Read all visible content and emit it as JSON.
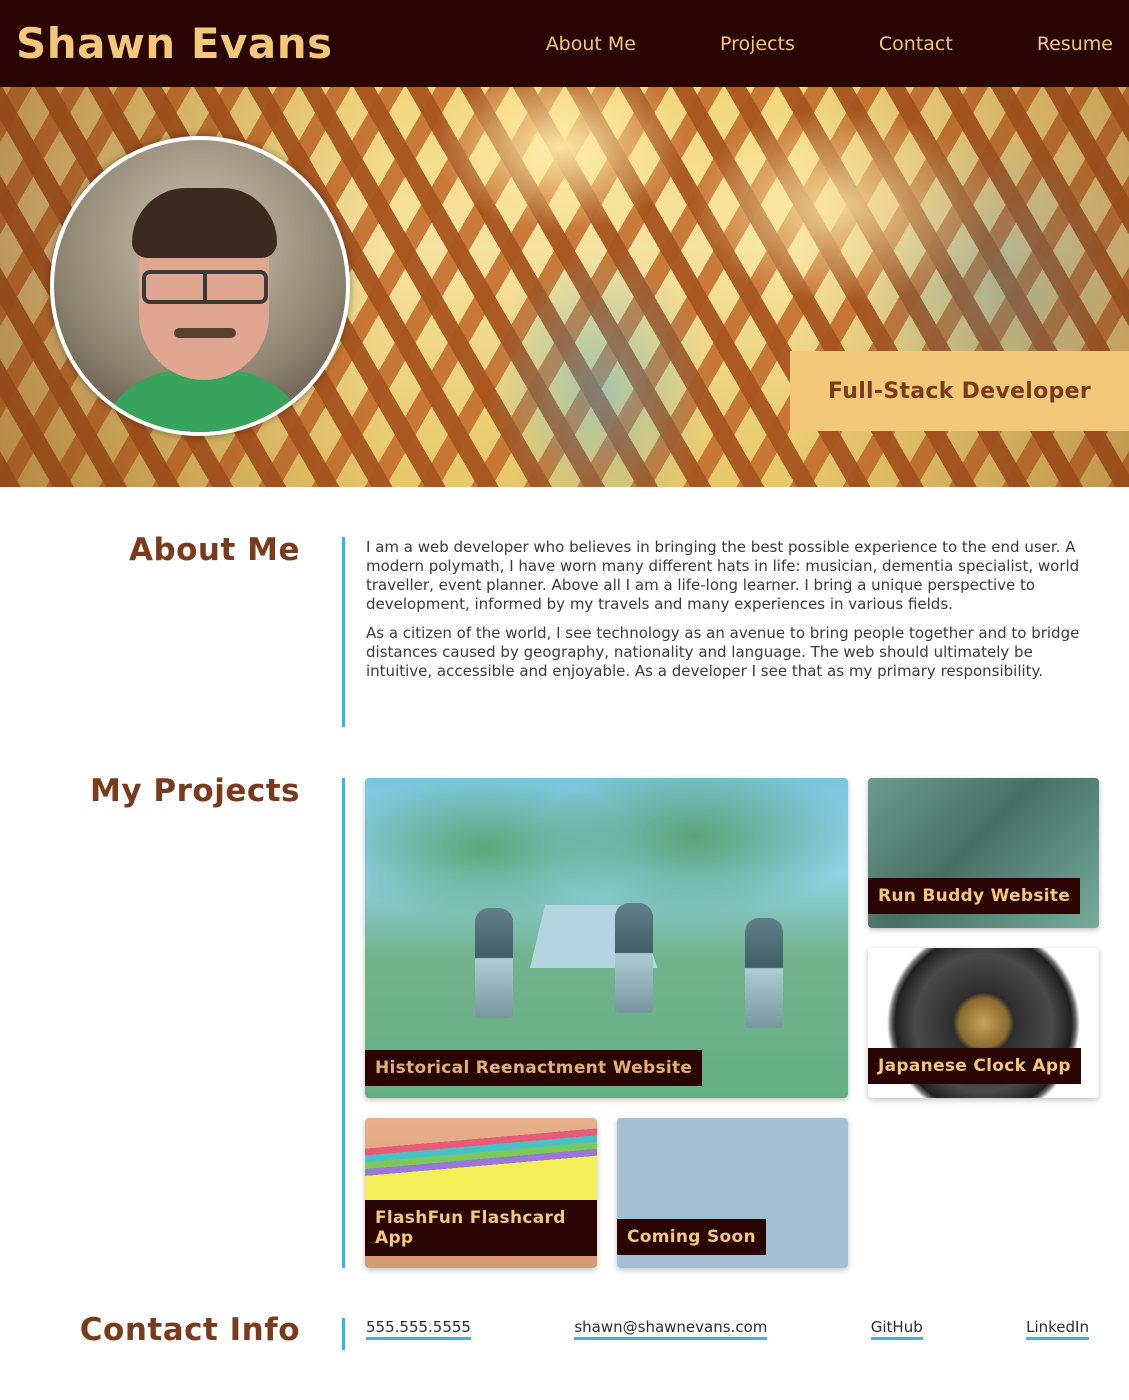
{
  "header": {
    "title": "Shawn Evans",
    "nav": [
      "About Me",
      "Projects",
      "Contact",
      "Resume"
    ]
  },
  "hero": {
    "tagline": "Full-Stack Developer",
    "avatar_icon": "profile-photo"
  },
  "about": {
    "heading": "About Me",
    "paragraphs": [
      "I am a web developer who believes in bringing the best possible experience to the end user. A modern polymath, I have worn many different hats in life: musician, dementia specialist, world traveller, event planner. Above all I am a life-long learner. I bring a unique perspective to development, informed by my travels and many experiences in various fields.",
      "As a citizen of the world, I see technology as an avenue to bring people together and to bridge distances caused by geography, nationality and language. The web should ultimately be intuitive, accessible and enjoyable. As a developer I see that as my primary responsibility."
    ]
  },
  "projects": {
    "heading": "My Projects",
    "items": [
      {
        "label": "Historical Reenactment Website"
      },
      {
        "label": "Run Buddy Website"
      },
      {
        "label": "Japanese Clock App"
      },
      {
        "label": "FlashFun Flashcard App"
      },
      {
        "label": "Coming Soon"
      }
    ]
  },
  "contact": {
    "heading": "Contact Info",
    "phone": "555.555.5555",
    "email": "shawn@shawnevans.com",
    "github": "GitHub",
    "linkedin": "LinkedIn"
  },
  "colors": {
    "header_bg": "#2a0303",
    "accent_gold": "#f3c879",
    "heading_brown": "#7a3b1c",
    "rule_blue": "#35b6e0"
  }
}
